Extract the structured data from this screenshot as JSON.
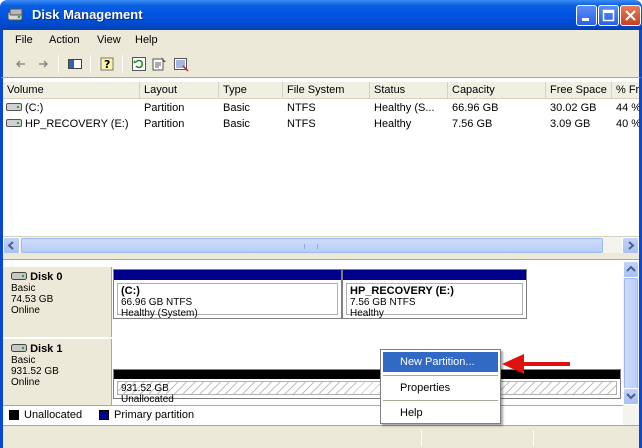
{
  "window": {
    "title": "Disk Management"
  },
  "menu": [
    "File",
    "Action",
    "View",
    "Help"
  ],
  "toolbar_icons": [
    "back-arrow-icon",
    "forward-arrow-icon",
    "console-tree-icon",
    "help-icon",
    "refresh-icon",
    "properties-icon",
    "export-icon"
  ],
  "volume_table": {
    "columns": [
      "Volume",
      "Layout",
      "Type",
      "File System",
      "Status",
      "Capacity",
      "Free Space",
      "% Fr"
    ],
    "rows": [
      [
        "(C:)",
        "Partition",
        "Basic",
        "NTFS",
        "Healthy (S...",
        "66.96 GB",
        "30.02 GB",
        "44 %"
      ],
      [
        "HP_RECOVERY (E:)",
        "Partition",
        "Basic",
        "NTFS",
        "Healthy",
        "7.56 GB",
        "3.09 GB",
        "40 %"
      ]
    ]
  },
  "disks": [
    {
      "name": "Disk 0",
      "type": "Basic",
      "size": "74.53 GB",
      "state": "Online",
      "partitions": [
        {
          "title": "(C:)",
          "line1": "66.96 GB NTFS",
          "line2": "Healthy (System)"
        },
        {
          "title": "HP_RECOVERY  (E:)",
          "line1": "7.56 GB NTFS",
          "line2": "Healthy"
        }
      ]
    },
    {
      "name": "Disk 1",
      "type": "Basic",
      "size": "931.52 GB",
      "state": "Online",
      "partitions": [
        {
          "title": "",
          "line1": "931.52 GB",
          "line2": "Unallocated"
        }
      ]
    }
  ],
  "legend": [
    {
      "label": "Unallocated",
      "color": "#000000"
    },
    {
      "label": "Primary partition",
      "color": "#00008b"
    }
  ],
  "context_menu": {
    "items": [
      "New Partition...",
      "Properties",
      "Help"
    ],
    "highlighted": "New Partition..."
  },
  "colors": {
    "primary_bar": "#00008b",
    "unallocated_bar": "#000000",
    "highlight": "#316ac5",
    "annotation_arrow": "#e01010"
  }
}
